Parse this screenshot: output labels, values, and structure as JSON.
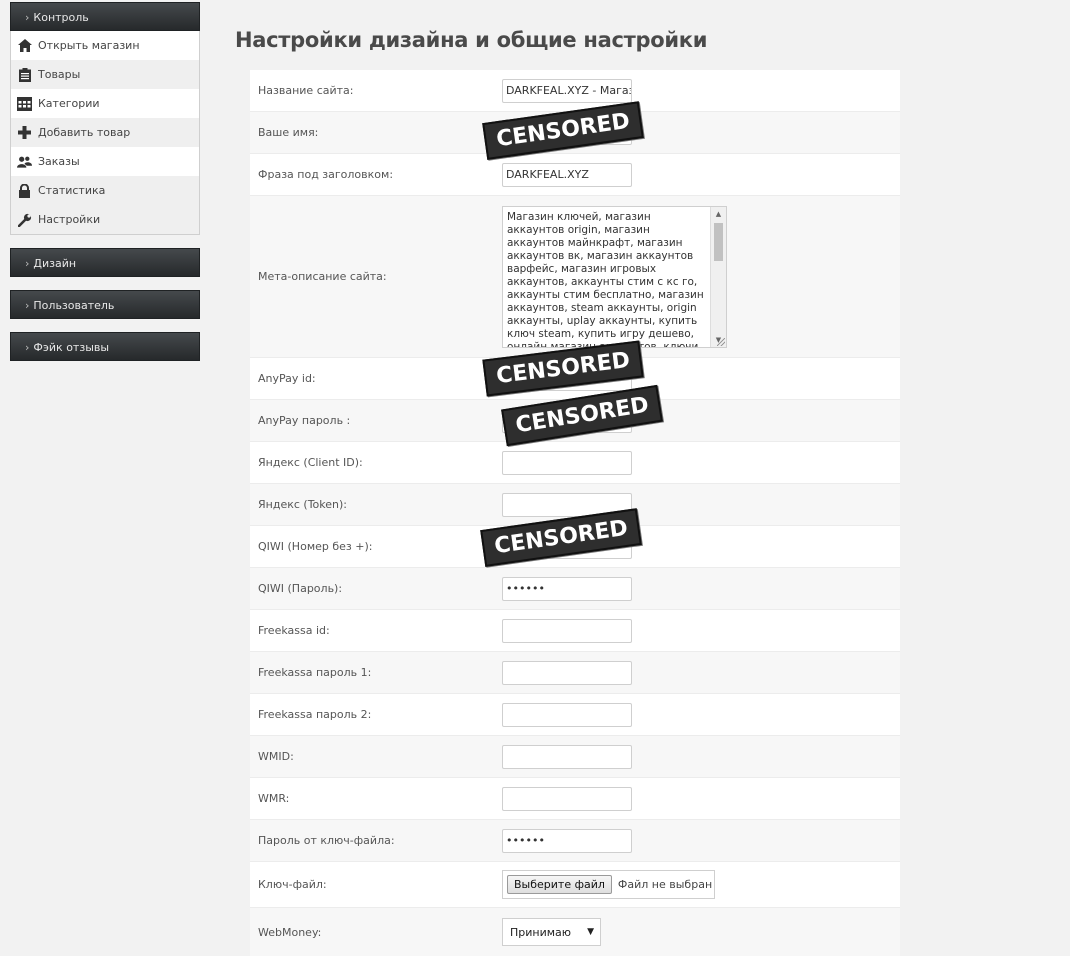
{
  "sidebar": {
    "sections": [
      {
        "label": "Контроль"
      },
      {
        "label": "Дизайн"
      },
      {
        "label": "Пользователь"
      },
      {
        "label": "Фэйк отзывы"
      }
    ],
    "items": [
      {
        "label": "Открыть магазин",
        "icon": "home-icon"
      },
      {
        "label": "Товары",
        "icon": "clipboard-icon"
      },
      {
        "label": "Категории",
        "icon": "calendar-icon"
      },
      {
        "label": "Добавить товар",
        "icon": "plus-icon"
      },
      {
        "label": "Заказы",
        "icon": "users-icon"
      },
      {
        "label": "Статистика",
        "icon": "lock-icon"
      },
      {
        "label": "Настройки",
        "icon": "wrench-icon"
      }
    ]
  },
  "page": {
    "title": "Настройки дизайна и общие настройки"
  },
  "form": {
    "site_name": {
      "label": "Название сайта:",
      "value": "DARKFEAL.XYZ  - Магазин"
    },
    "your_name": {
      "label": "Ваше имя:",
      "value": ""
    },
    "tagline": {
      "label": "Фраза под заголовком:",
      "value": "DARKFEAL.XYZ"
    },
    "meta": {
      "label": "Мета-описание сайта:",
      "value": "Магазин ключей, магазин аккаунтов origin, магазин аккаунтов майнкрафт, магазин аккаунтов вк, магазин аккаунтов варфейс, магазин игровых аккаунтов, аккаунты стим с кс го, аккаунты стим бесплатно, магазин аккаунтов, steam аккаунты, origin аккаунты, uplay аккаунты, купить ключ steam, купить игру дешево, онлайн магазин аккаунтов, ключи для"
    },
    "anypay_id": {
      "label": "AnyPay id:",
      "value": ""
    },
    "anypay_pass": {
      "label": "AnyPay пароль :",
      "value": ""
    },
    "yandex_client": {
      "label": "Яндекс (Client ID):",
      "value": ""
    },
    "yandex_token": {
      "label": "Яндекс (Token):",
      "value": ""
    },
    "qiwi_number": {
      "label": "QIWI (Номер без +):",
      "value": ""
    },
    "qiwi_pass": {
      "label": "QIWI (Пароль):",
      "value": "••••••"
    },
    "freekassa_id": {
      "label": "Freekassa id:",
      "value": ""
    },
    "freekassa_pass1": {
      "label": "Freekassa пароль 1:",
      "value": ""
    },
    "freekassa_pass2": {
      "label": "Freekassa пароль 2:",
      "value": ""
    },
    "wmid": {
      "label": "WMID:",
      "value": ""
    },
    "wmr": {
      "label": "WMR:",
      "value": ""
    },
    "keyfile_pass": {
      "label": "Пароль от ключ-файла:",
      "value": "••••••"
    },
    "keyfile": {
      "label": "Ключ-файл:",
      "button": "Выберите файл",
      "status": "Файл не выбран"
    },
    "webmoney": {
      "label": "WebMoney:",
      "selected": "Принимаю"
    }
  },
  "censor": {
    "text": "CENSORED"
  }
}
